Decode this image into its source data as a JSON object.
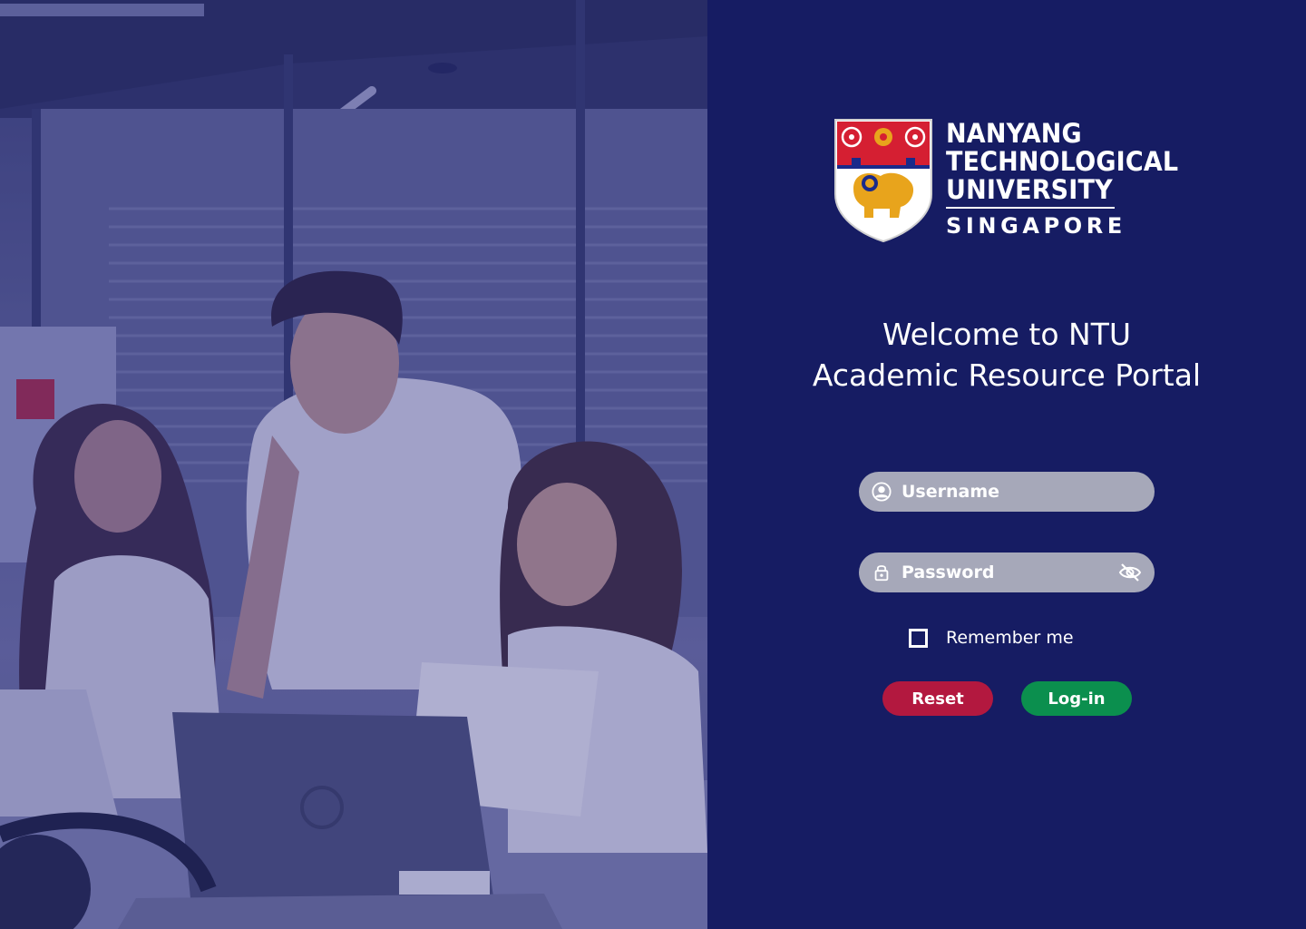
{
  "logo": {
    "line1": "NANYANG",
    "line2": "TECHNOLOGICAL",
    "line3": "UNIVERSITY",
    "subline": "SINGAPORE"
  },
  "welcome": {
    "line1": "Welcome to NTU",
    "line2": "Academic Resource Portal"
  },
  "form": {
    "username": {
      "placeholder": "Username",
      "value": "",
      "icon": "user-circle-icon"
    },
    "password": {
      "placeholder": "Password",
      "value": "",
      "icon": "lock-icon",
      "toggle_icon": "eye-off-icon"
    },
    "remember_label": "Remember me",
    "remember_checked": false,
    "reset_label": "Reset",
    "login_label": "Log-in"
  },
  "colors": {
    "panel_bg": "#161c63",
    "field_bg": "#a6a8b9",
    "reset": "#b3183f",
    "login": "#0b8f4e",
    "logo_red": "#d51f32",
    "logo_gold": "#e8a41c"
  }
}
